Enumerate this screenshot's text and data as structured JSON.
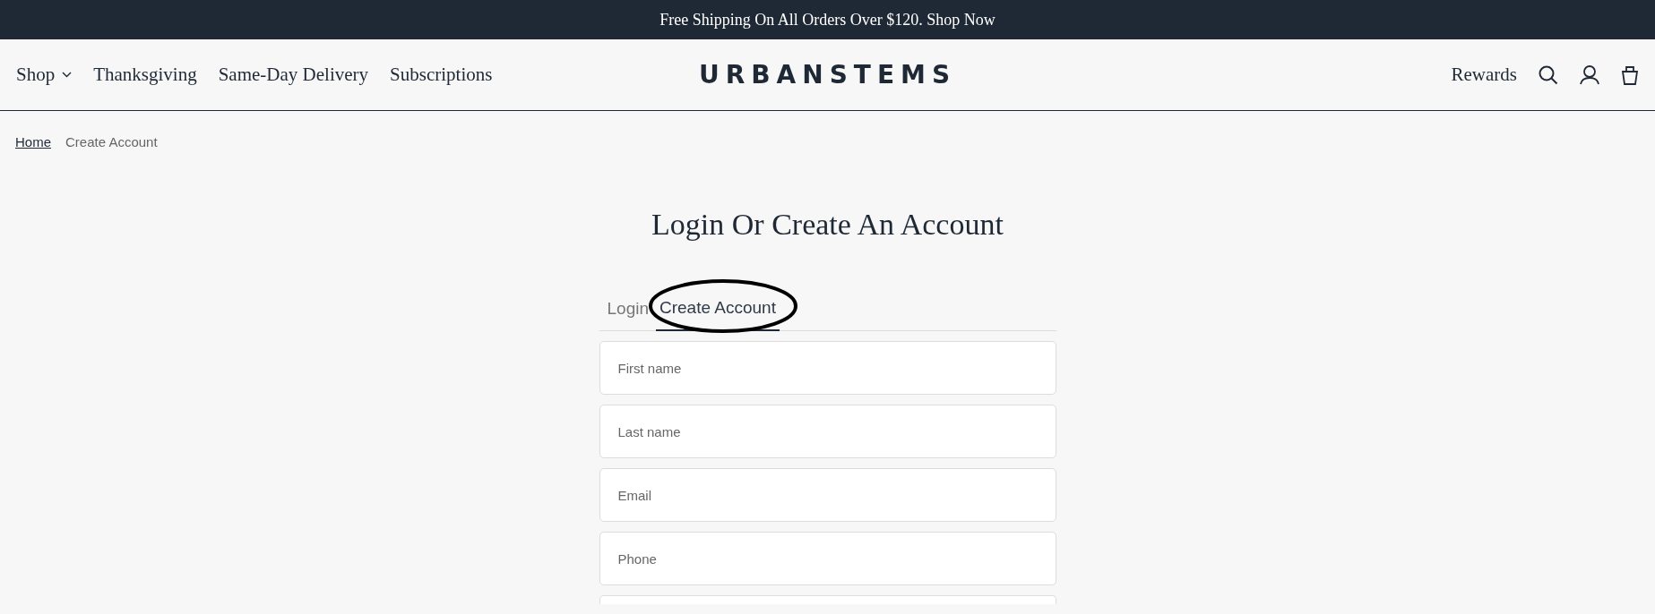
{
  "announcement": "Free Shipping On All Orders Over $120. Shop Now",
  "nav": {
    "items": [
      {
        "label": "Shop",
        "dropdown": true
      },
      {
        "label": "Thanksgiving",
        "dropdown": false
      },
      {
        "label": "Same-Day Delivery",
        "dropdown": false
      },
      {
        "label": "Subscriptions",
        "dropdown": false
      }
    ],
    "logo": "URBANSTEMS",
    "rewards": "Rewards"
  },
  "breadcrumb": [
    {
      "label": "Home",
      "link": true
    },
    {
      "label": "Create Account",
      "link": false
    }
  ],
  "heading": "Login Or Create An Account",
  "tabs": [
    {
      "label": "Login",
      "selected": false,
      "circled": false
    },
    {
      "label": "Create Account",
      "selected": true,
      "circled": true
    }
  ],
  "fields": [
    {
      "placeholder": "First name"
    },
    {
      "placeholder": "Last name"
    },
    {
      "placeholder": "Email"
    },
    {
      "placeholder": "Phone"
    }
  ],
  "more_fields_below": true
}
